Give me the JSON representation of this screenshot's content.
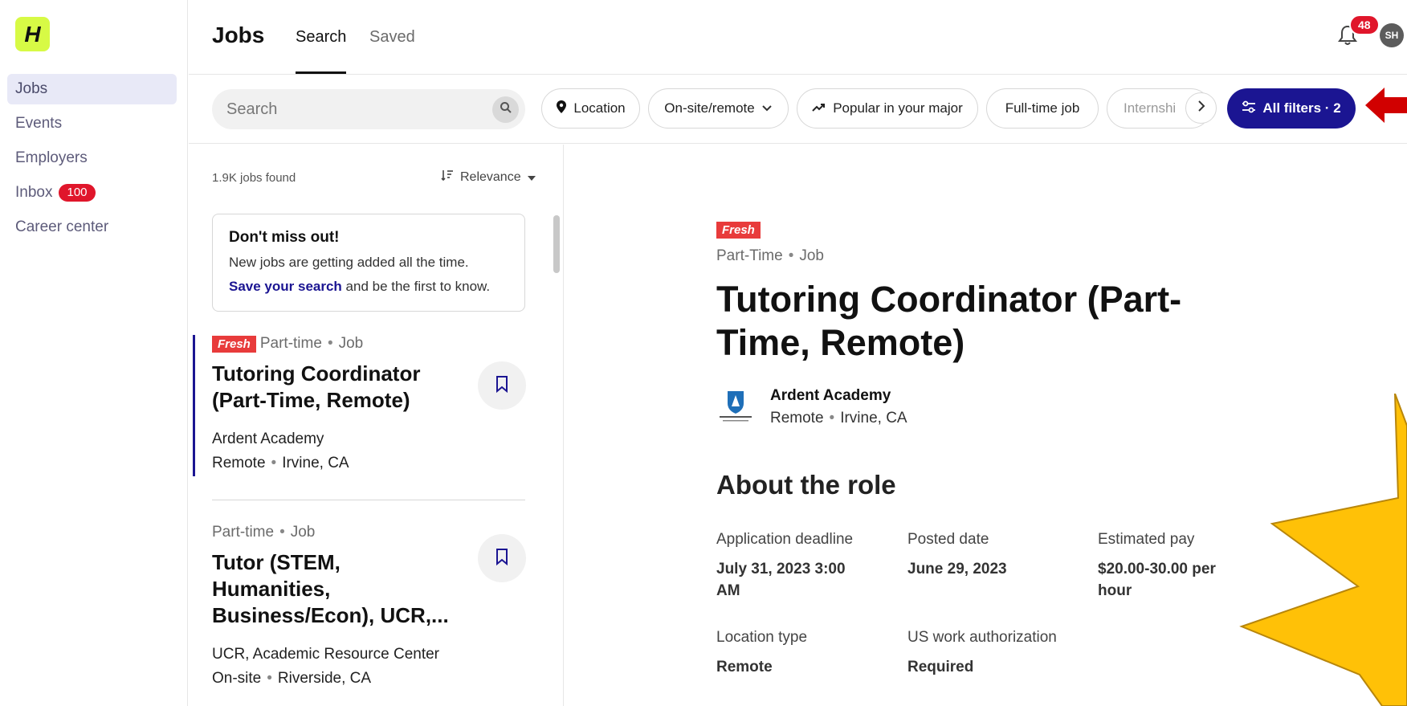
{
  "sidebar": {
    "logo_letter": "H",
    "items": [
      {
        "label": "Jobs"
      },
      {
        "label": "Events"
      },
      {
        "label": "Employers"
      },
      {
        "label": "Inbox",
        "badge": "100"
      },
      {
        "label": "Career center"
      }
    ]
  },
  "header": {
    "title": "Jobs",
    "tabs": [
      {
        "label": "Search"
      },
      {
        "label": "Saved"
      }
    ],
    "notifications": "48",
    "avatar_initials": "SH"
  },
  "filters": {
    "search_placeholder": "Search",
    "chips": [
      {
        "label": "Location",
        "icon": "pin-icon"
      },
      {
        "label": "On-site/remote",
        "icon": "chevron-down-icon"
      },
      {
        "label": "Popular in your major",
        "icon": "trending-icon"
      },
      {
        "label": "Full-time job"
      },
      {
        "label": "Internshi"
      }
    ],
    "all_filters_label": "All filters · 2"
  },
  "results": {
    "count": "1.9K jobs found",
    "sort_label": "Relevance",
    "promo": {
      "title": "Don't miss out!",
      "line1": "New jobs are getting added all the time.",
      "link": "Save your search",
      "line2_rest": " and be the first to know."
    },
    "jobs": [
      {
        "tag": "Fresh",
        "type": "Part-time",
        "kind": "Job",
        "title": "Tutoring Coordinator (Part-Time, Remote)",
        "company": "Ardent Academy",
        "location_type": "Remote",
        "city": "Irvine, CA"
      },
      {
        "type": "Part-time",
        "kind": "Job",
        "title": "Tutor (STEM, Humanities, Business/Econ), UCR,...",
        "company": "UCR, Academic Resource Center",
        "location_type": "On-site",
        "city": "Riverside, CA"
      }
    ]
  },
  "detail": {
    "tag": "Fresh",
    "type": "Part-Time",
    "kind": "Job",
    "title": "Tutoring Coordinator (Part-Time, Remote)",
    "company": "Ardent Academy",
    "location_type": "Remote",
    "city": "Irvine, CA",
    "about_heading": "About the role",
    "info": {
      "deadline_label": "Application deadline",
      "deadline_value": "July 31, 2023 3:00 AM",
      "posted_label": "Posted date",
      "posted_value": "June 29, 2023",
      "pay_label": "Estimated pay",
      "pay_value": "$20.00-30.00 per hour",
      "loctype_label": "Location type",
      "loctype_value": "Remote",
      "auth_label": "US work authorization",
      "auth_value": "Required"
    }
  },
  "colors": {
    "accent": "#1b1592",
    "logo_bg": "#d7fa45",
    "badge_red": "#e0162b",
    "fresh_red": "#e83b3b",
    "annotation_arrow": "#d10000",
    "annotation_burst": "#ffc107"
  }
}
